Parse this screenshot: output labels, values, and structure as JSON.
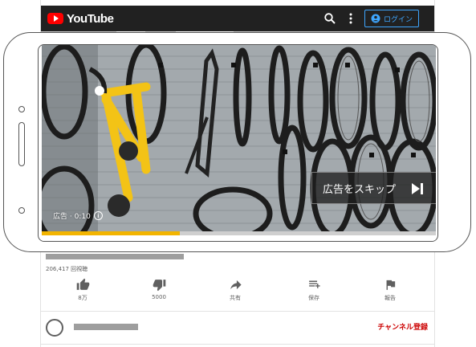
{
  "header": {
    "logo_text": "YouTube",
    "login_label": "ログイン",
    "search_icon": "search-icon",
    "more_icon": "more-vert-icon",
    "account_icon": "account-circle-icon",
    "background_color": "#212121",
    "accent_color": "#3ea6ff"
  },
  "video": {
    "ad_label": "広告 · 0:10",
    "skip_label": "広告をスキップ",
    "progress_fraction": 0.35,
    "progress_color": "#f2b400"
  },
  "details": {
    "views": "206,417 回視聴",
    "actions": [
      {
        "name": "like",
        "icon": "thumb-up-icon",
        "label": "8万"
      },
      {
        "name": "dislike",
        "icon": "thumb-down-icon",
        "label": "5000"
      },
      {
        "name": "share",
        "icon": "share-icon",
        "label": "共有"
      },
      {
        "name": "save",
        "icon": "playlist-add-icon",
        "label": "保存"
      },
      {
        "name": "report",
        "icon": "flag-icon",
        "label": "報告"
      }
    ],
    "subscribe_label": "チャンネル登録",
    "subscribe_color": "#cc0000"
  }
}
